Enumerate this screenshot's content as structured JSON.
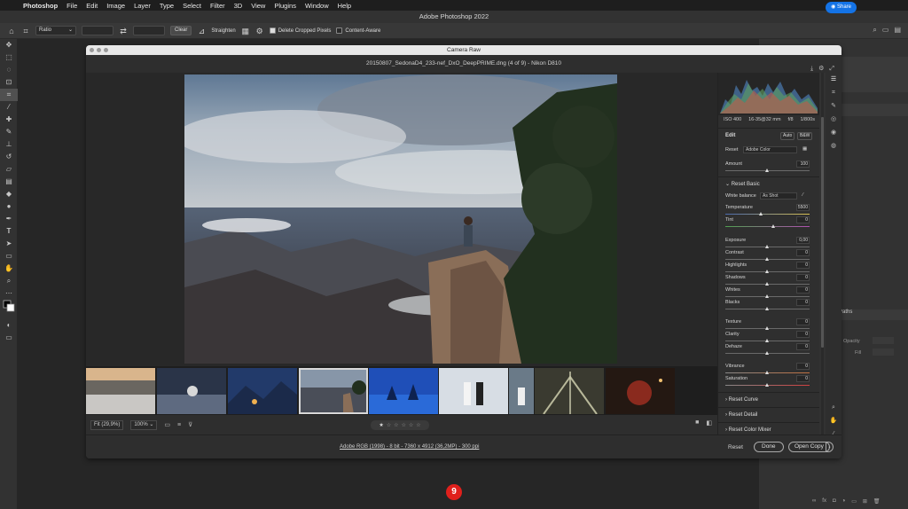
{
  "menubar": {
    "items": [
      "Photoshop",
      "File",
      "Edit",
      "Image",
      "Layer",
      "Type",
      "Select",
      "Filter",
      "3D",
      "View",
      "Plugins",
      "Window",
      "Help"
    ]
  },
  "window_title": "Adobe Photoshop 2022",
  "optbar": {
    "ratio": "Ratio",
    "clear": "Clear",
    "straighten": "Straighten",
    "delete_cropped": "Delete Cropped Pixels",
    "delete_cropped_checked": true,
    "content_aware": "Content-Aware",
    "content_aware_checked": false,
    "share": "Share"
  },
  "camera_raw": {
    "title": "Camera Raw",
    "file_info": "20150807_SedonaD4_233-nef_DxO_DeepPRIME.dng (4 of 9)  -  Nikon D810",
    "exif": [
      "ISO 400",
      "16-35@32 mm",
      "f/8",
      "1/800s"
    ],
    "edit_label": "Edit",
    "auto": "Auto",
    "bw": "B&W",
    "profile_label": "Reset",
    "profile_value": "Adobe Color",
    "amount_label": "Amount",
    "amount_value": "100",
    "basic_header": "Reset Basic",
    "wb_label": "White balance",
    "wb_value": "As Shot",
    "sliders": [
      {
        "label": "Temperature",
        "value": "5500"
      },
      {
        "label": "Tint",
        "value": "0"
      },
      {
        "label": "Exposure",
        "value": "0,00"
      },
      {
        "label": "Contrast",
        "value": "0"
      },
      {
        "label": "Highlights",
        "value": "0"
      },
      {
        "label": "Shadows",
        "value": "0"
      },
      {
        "label": "Whites",
        "value": "0"
      },
      {
        "label": "Blacks",
        "value": "0"
      },
      {
        "label": "Texture",
        "value": "0"
      },
      {
        "label": "Clarity",
        "value": "0"
      },
      {
        "label": "Dehaze",
        "value": "0"
      },
      {
        "label": "Vibrance",
        "value": "0"
      },
      {
        "label": "Saturation",
        "value": "0"
      }
    ],
    "sections": [
      "Reset Curve",
      "Reset Detail",
      "Reset Color Mixer"
    ],
    "zoom_fit": "Fit (29,9%)",
    "zoom_pct": "100%",
    "footer_info": "Adobe RGB (1998) - 8 bit - 7360 x 4912 (36,2MP) - 300 ppi",
    "reset": "Reset",
    "done": "Done",
    "open_copy": "Open Copy"
  },
  "right_panel": {
    "paths": "Paths",
    "opacity": "Opacity",
    "fill": "Fill"
  },
  "badge": "9",
  "colors": {
    "accent": "#1473e6",
    "badge": "#e0201c"
  }
}
